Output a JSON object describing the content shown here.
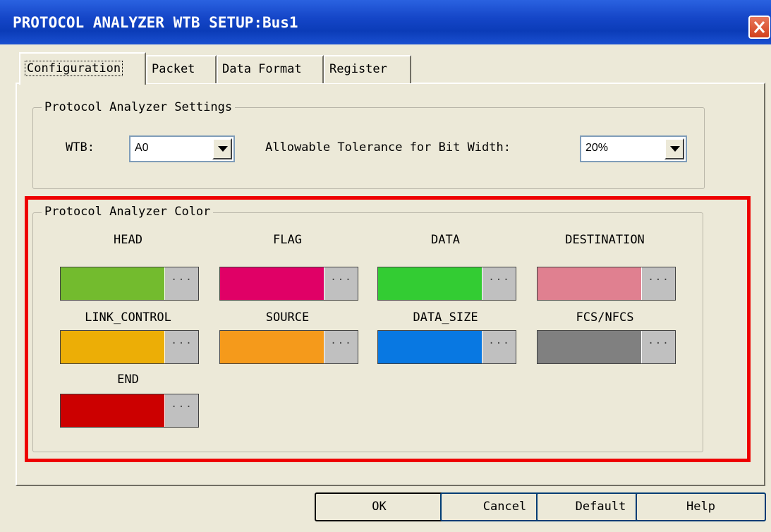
{
  "window": {
    "title": "PROTOCOL ANALYZER WTB SETUP:Bus1"
  },
  "tabs": [
    "Configuration",
    "Packet",
    "Data Format",
    "Register"
  ],
  "settings": {
    "group_title": "Protocol Analyzer Settings",
    "wtb_label": "WTB:",
    "wtb_value": "A0",
    "tolerance_label": "Allowable Tolerance for Bit Width:",
    "tolerance_value": "20%"
  },
  "colors": {
    "group_title": "Protocol Analyzer Color",
    "dots": "...",
    "items": [
      {
        "label": "HEAD",
        "color": "#73bb2e"
      },
      {
        "label": "FLAG",
        "color": "#e00066"
      },
      {
        "label": "DATA",
        "color": "#33cc33"
      },
      {
        "label": "DESTINATION",
        "color": "#e08090"
      },
      {
        "label": "LINK_CONTROL",
        "color": "#ecae06"
      },
      {
        "label": "SOURCE",
        "color": "#f59a1b"
      },
      {
        "label": "DATA_SIZE",
        "color": "#0878e2"
      },
      {
        "label": "FCS/NFCS",
        "color": "#808080"
      },
      {
        "label": "END",
        "color": "#cc0000"
      }
    ]
  },
  "buttons": {
    "ok": "OK",
    "cancel": "Cancel",
    "default": "Default",
    "help": "Help"
  }
}
